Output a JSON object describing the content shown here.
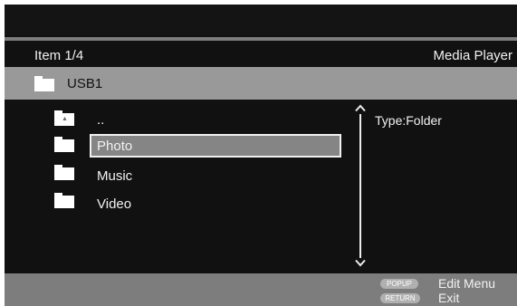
{
  "header": {
    "item_counter": "Item 1/4",
    "app_title": "Media Player"
  },
  "path": {
    "label": "USB1",
    "icon": "folder-icon"
  },
  "list": {
    "items": [
      {
        "label": "..",
        "icon": "parent-folder-icon",
        "selected": false
      },
      {
        "label": "Photo",
        "icon": "folder-icon",
        "selected": true
      },
      {
        "label": "Music",
        "icon": "folder-icon",
        "selected": false
      },
      {
        "label": "Video",
        "icon": "folder-icon",
        "selected": false
      }
    ]
  },
  "info": {
    "type_text": "Type:Folder"
  },
  "footer": {
    "hints": [
      {
        "button": "POPUP",
        "action": "Edit Menu"
      },
      {
        "button": "RETURN",
        "action": "Exit"
      }
    ]
  },
  "colors": {
    "background": "#111111",
    "bar_gray": "#999999",
    "footer_gray": "#7d7d7d",
    "selection_fill": "#858585",
    "text": "#f2f2f2"
  }
}
